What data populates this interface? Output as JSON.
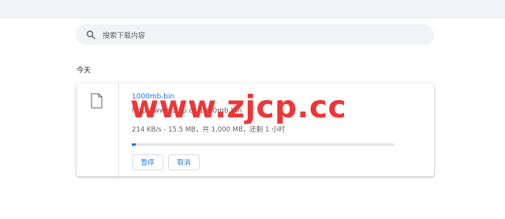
{
  "search": {
    "placeholder": "搜索下载内容"
  },
  "section": {
    "title": "今天"
  },
  "download": {
    "filename": "1000mb.bin",
    "url": "http://www.zjcp.cc/1000mb.bin",
    "status": "214 KB/s - 15.5 MB，共 1,000 MB，还剩 1 小时",
    "progress_percent": 1.55,
    "pause_label": "暂停",
    "cancel_label": "取消"
  },
  "watermark": {
    "text": "www.zjcp.cc"
  },
  "colors": {
    "accent": "#1a73e8",
    "watermark": "#ef2b2b"
  },
  "icons": {
    "search": "search-icon",
    "file": "file-icon"
  }
}
